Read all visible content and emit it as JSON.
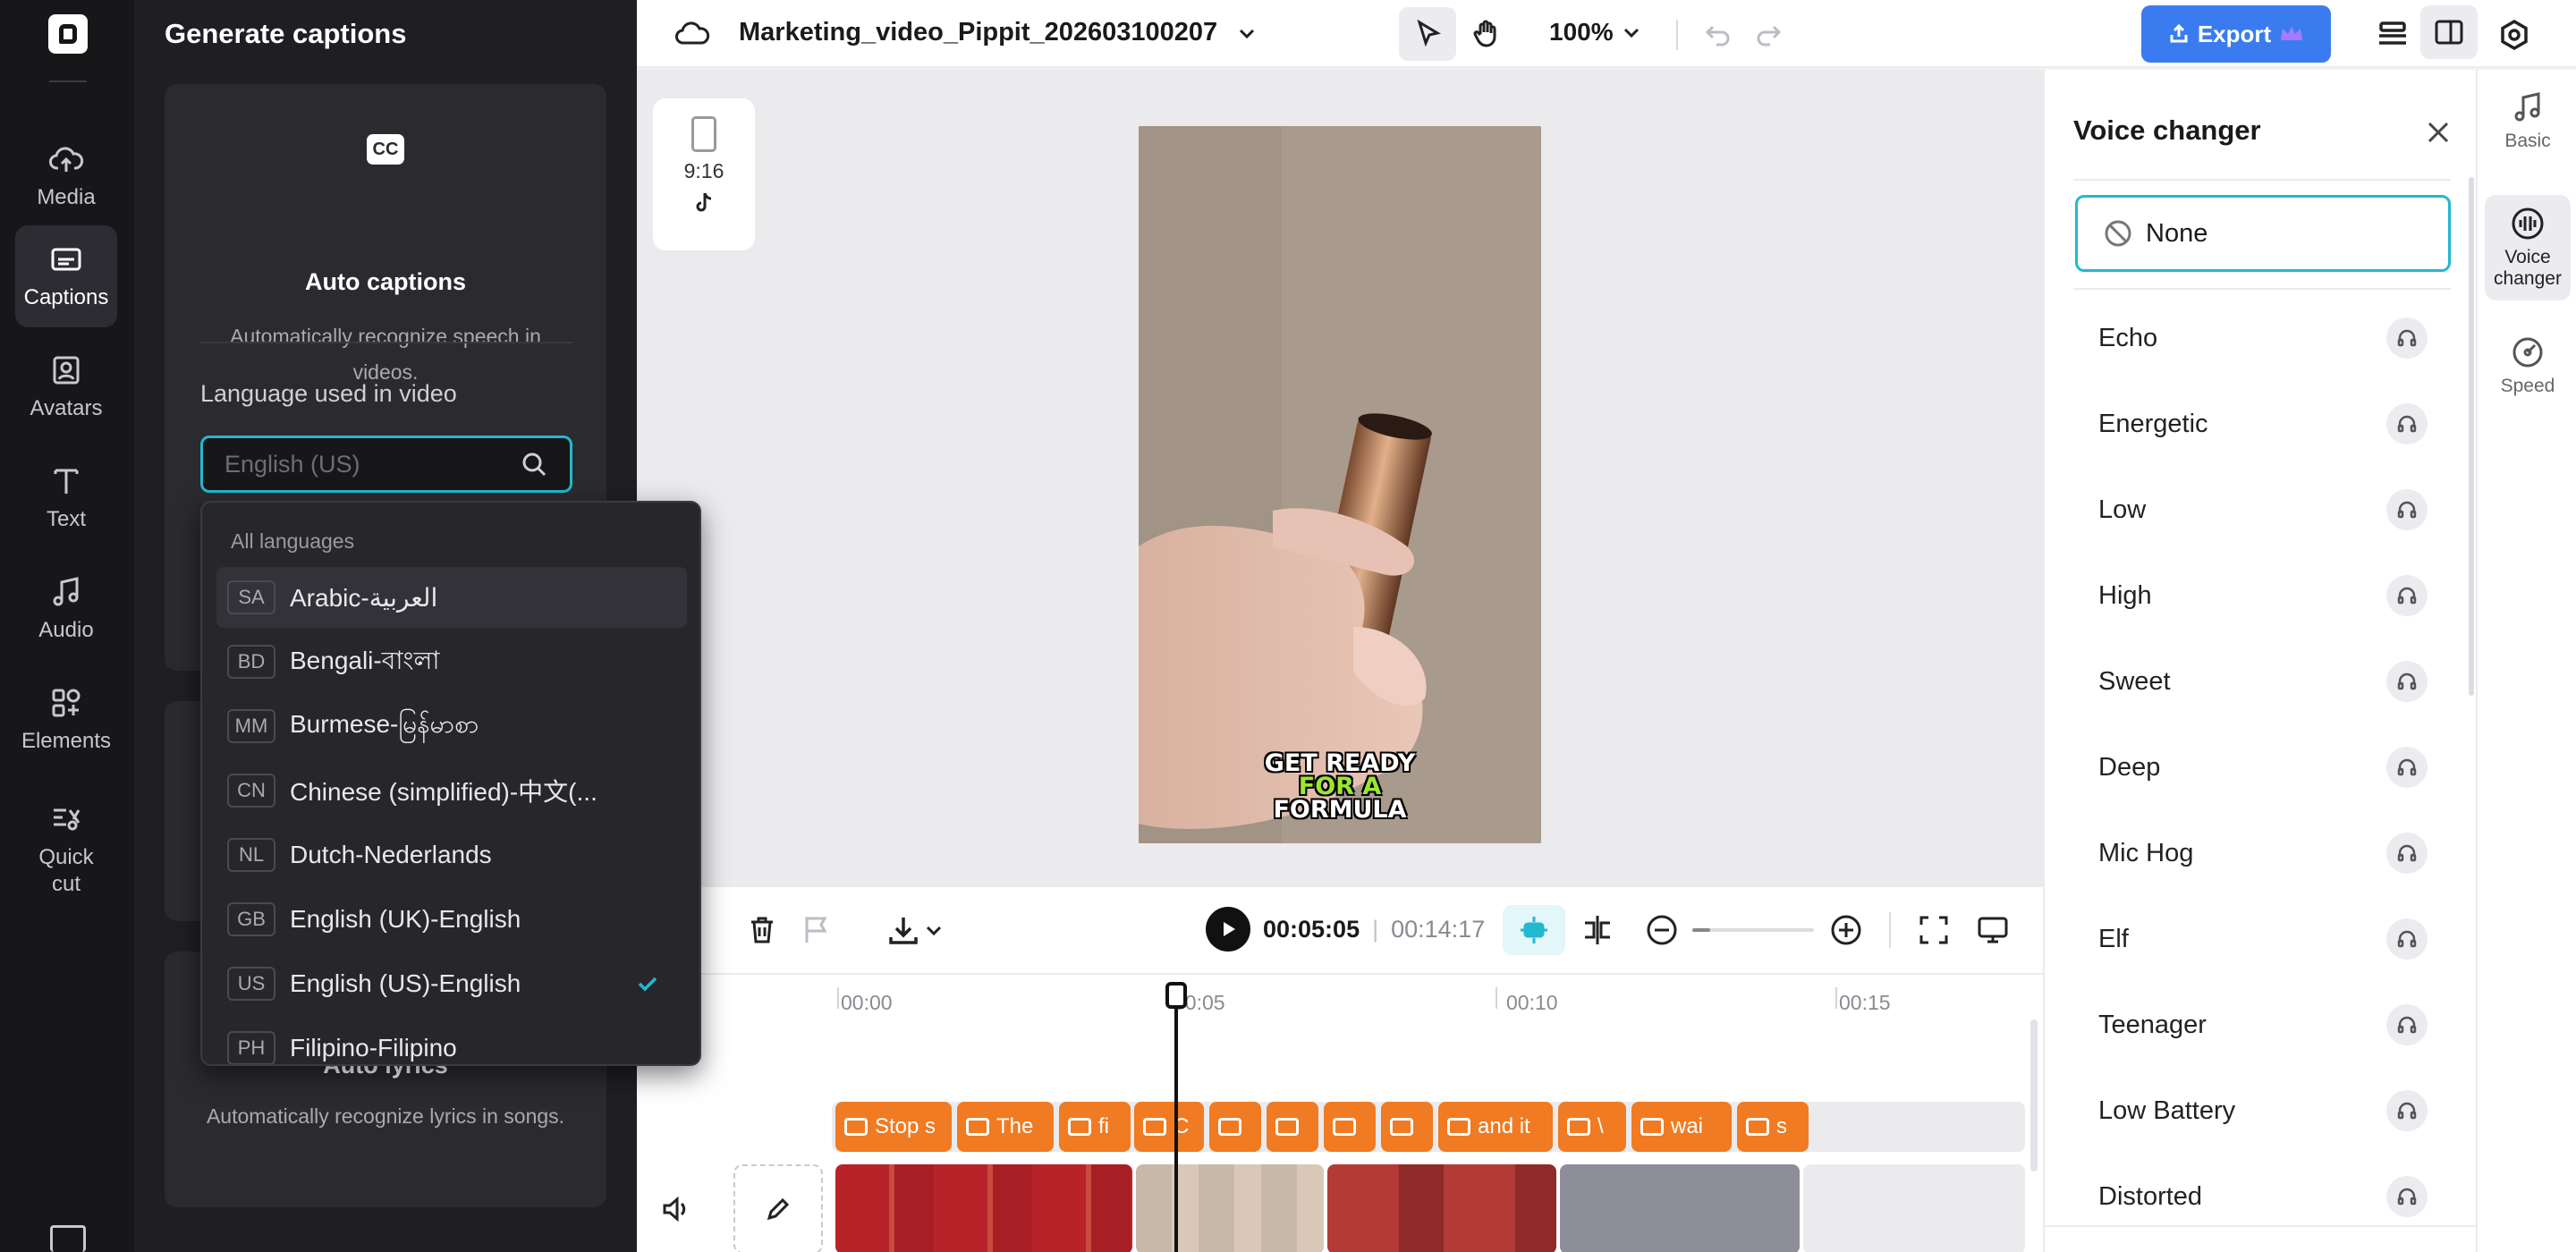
{
  "rail": {
    "items": [
      {
        "label": "Media",
        "icon": "cloud-upload-icon"
      },
      {
        "label": "Captions",
        "icon": "captions-icon"
      },
      {
        "label": "Avatars",
        "icon": "avatar-icon"
      },
      {
        "label": "Text",
        "icon": "text-icon"
      },
      {
        "label": "Audio",
        "icon": "music-note-icon"
      },
      {
        "label": "Elements",
        "icon": "elements-icon"
      },
      {
        "label": "Quick cut",
        "icon": "quick-cut-icon"
      }
    ]
  },
  "captions_panel": {
    "title": "Generate captions",
    "auto_captions": {
      "icon_text": "CC",
      "title": "Auto captions",
      "description": "Automatically recognize speech in videos."
    },
    "language_label": "Language used in video",
    "language_placeholder": "English (US)",
    "auto_lyrics": {
      "title": "Auto lyrics",
      "description": "Automatically recognize lyrics in songs."
    }
  },
  "language_dropdown": {
    "header": "All languages",
    "items": [
      {
        "code": "SA",
        "label": "Arabic-العربية"
      },
      {
        "code": "BD",
        "label": "Bengali-বাংলা"
      },
      {
        "code": "MM",
        "label": "Burmese-မြန်မာစာ"
      },
      {
        "code": "CN",
        "label": "Chinese (simplified)-中文(..."
      },
      {
        "code": "NL",
        "label": "Dutch-Nederlands"
      },
      {
        "code": "GB",
        "label": "English (UK)-English"
      },
      {
        "code": "US",
        "label": "English (US)-English"
      },
      {
        "code": "PH",
        "label": "Filipino-Filipino"
      }
    ],
    "selected_index": 6
  },
  "topbar": {
    "project_title": "Marketing_video_Pippit_202603100207",
    "zoom": "100%",
    "export_label": "Export"
  },
  "canvas": {
    "ratio_label": "9:16",
    "caption_lines": [
      "GET READY",
      "FOR A",
      "FORMULA"
    ]
  },
  "timeline": {
    "current_time": "00:05:05",
    "total_time": "00:14:17",
    "ticks": [
      "00:00",
      "00:05",
      "00:10",
      "00:15"
    ],
    "caption_clips": [
      "Stop s",
      "The",
      "fi",
      "C",
      "",
      "",
      "",
      "",
      "and it",
      "\\",
      "wai",
      "s"
    ]
  },
  "voice_changer": {
    "title": "Voice changer",
    "none_label": "None",
    "options": [
      "Echo",
      "Energetic",
      "Low",
      "High",
      "Sweet",
      "Deep",
      "Mic Hog",
      "Elf",
      "Teenager",
      "Low Battery",
      "Distorted"
    ]
  },
  "right_tabs": [
    {
      "label": "Basic",
      "icon": "music-note-icon"
    },
    {
      "label": "Voice changer",
      "icon": "voice-wave-icon"
    },
    {
      "label": "Speed",
      "icon": "speed-gauge-icon"
    }
  ],
  "colors": {
    "accent": "#23b8d0",
    "export": "#3a7cf0",
    "caption_clip": "#f07b22",
    "rail_bg": "#17171a",
    "panel_bg": "#1f1f23"
  }
}
